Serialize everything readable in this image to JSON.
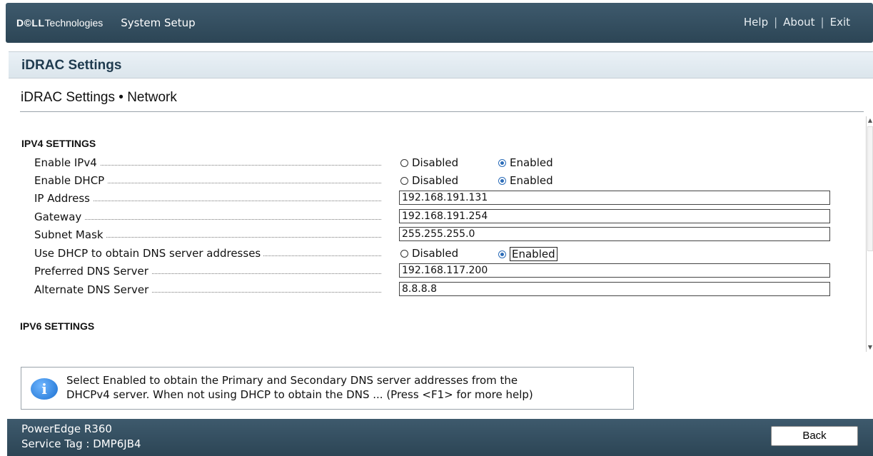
{
  "header": {
    "brand_bold": "D©LL",
    "brand_rest": "Technologies",
    "app_title": "System Setup",
    "links": [
      "Help",
      "About",
      "Exit"
    ],
    "separator": "|"
  },
  "panel": {
    "title": "iDRAC Settings",
    "breadcrumb": "iDRAC Settings • Network"
  },
  "ipv4": {
    "heading": "IPV4 SETTINGS",
    "enable_ipv4": {
      "label": "Enable IPv4",
      "opt1": "Disabled",
      "opt2": "Enabled",
      "selected": "Enabled"
    },
    "enable_dhcp": {
      "label": "Enable DHCP",
      "opt1": "Disabled",
      "opt2": "Enabled",
      "selected": "Enabled"
    },
    "ip_address": {
      "label": "IP Address",
      "value": "192.168.191.131"
    },
    "gateway": {
      "label": "Gateway",
      "value": "192.168.191.254"
    },
    "subnet_mask": {
      "label": "Subnet Mask",
      "value": "255.255.255.0"
    },
    "dhcp_dns": {
      "label": "Use DHCP to obtain DNS server addresses",
      "opt1": "Disabled",
      "opt2": "Enabled",
      "selected": "Enabled"
    },
    "preferred_dns": {
      "label": "Preferred DNS Server",
      "value": "192.168.117.200"
    },
    "alternate_dns": {
      "label": "Alternate DNS Server",
      "value": "8.8.8.8"
    }
  },
  "ipv6": {
    "heading": "IPV6 SETTINGS"
  },
  "help": {
    "icon": "info-icon",
    "line1": "Select Enabled to obtain the Primary and Secondary DNS server addresses from the",
    "line2": "DHCPv4 server. When not using DHCP to obtain the DNS ... (Press <F1> for more help)"
  },
  "footer": {
    "model": "PowerEdge R360",
    "service_tag": "Service Tag : DMP6JB4",
    "back_label": "Back"
  },
  "colors": {
    "bar": "#2c4555",
    "accent": "#2b6cb8",
    "panel_head": "#dbe5ec"
  }
}
